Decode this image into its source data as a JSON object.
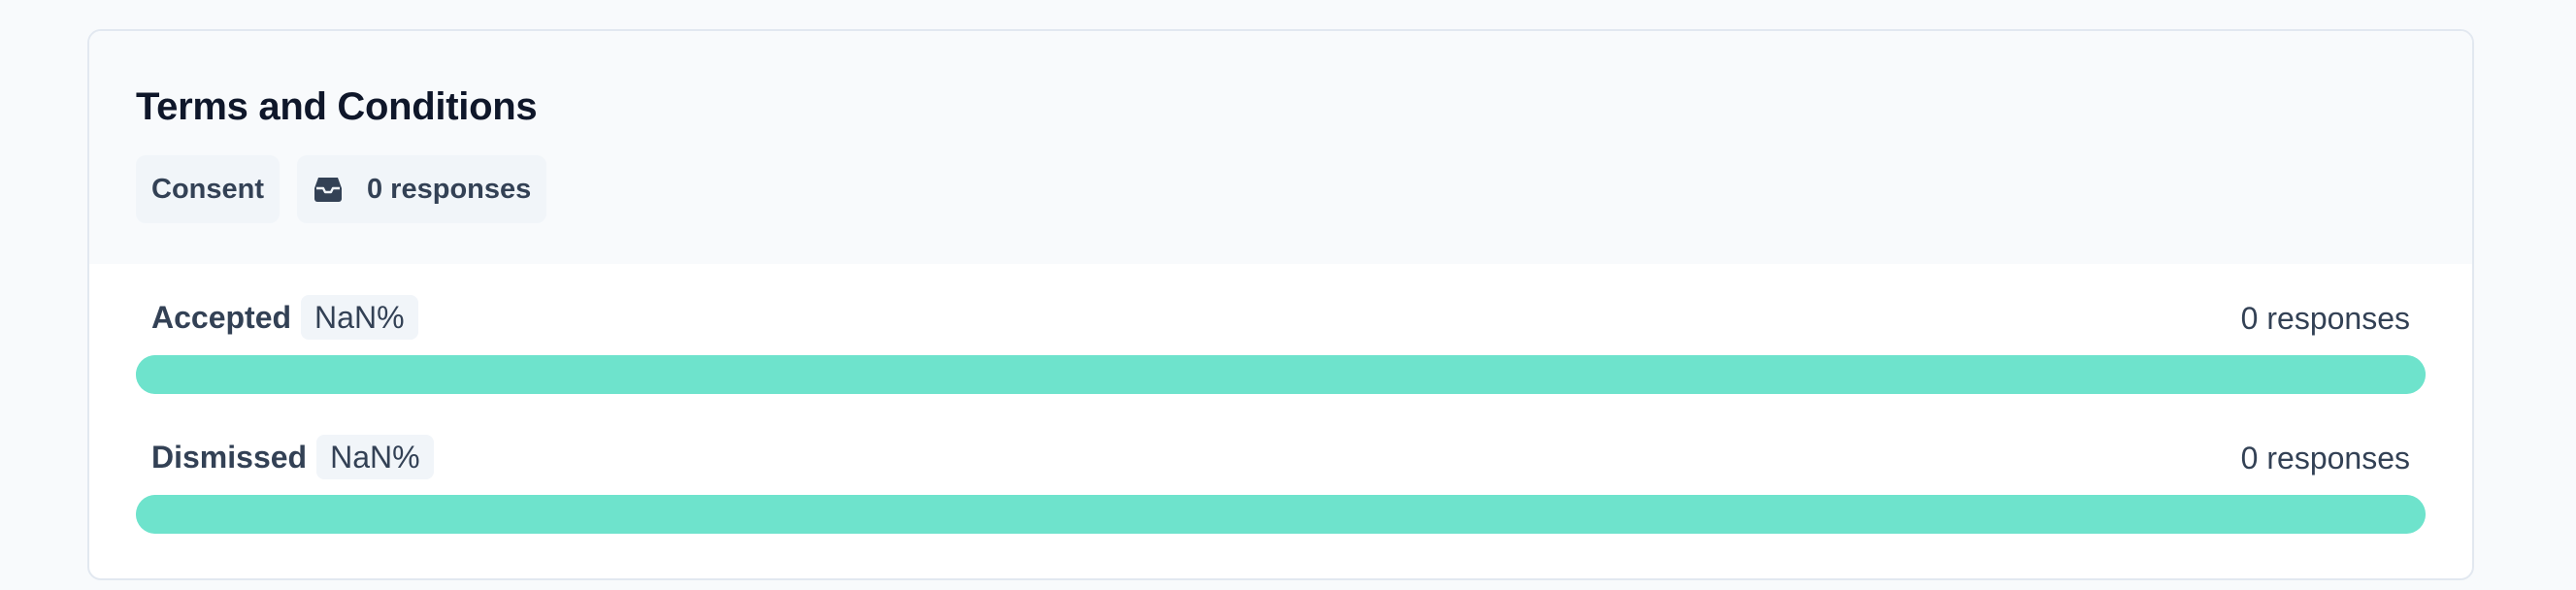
{
  "question": {
    "title": "Terms and Conditions",
    "type_label": "Consent",
    "response_count_label": "0 responses",
    "response_icon": "inbox-icon"
  },
  "results": [
    {
      "label": "Accepted",
      "percentage": "NaN%",
      "responses": "0 responses"
    },
    {
      "label": "Dismissed",
      "percentage": "NaN%",
      "responses": "0 responses"
    }
  ],
  "colors": {
    "bar": "#6ee3cc",
    "chip_bg": "#f1f5f9",
    "text": "#334155",
    "title": "#0f172a"
  }
}
